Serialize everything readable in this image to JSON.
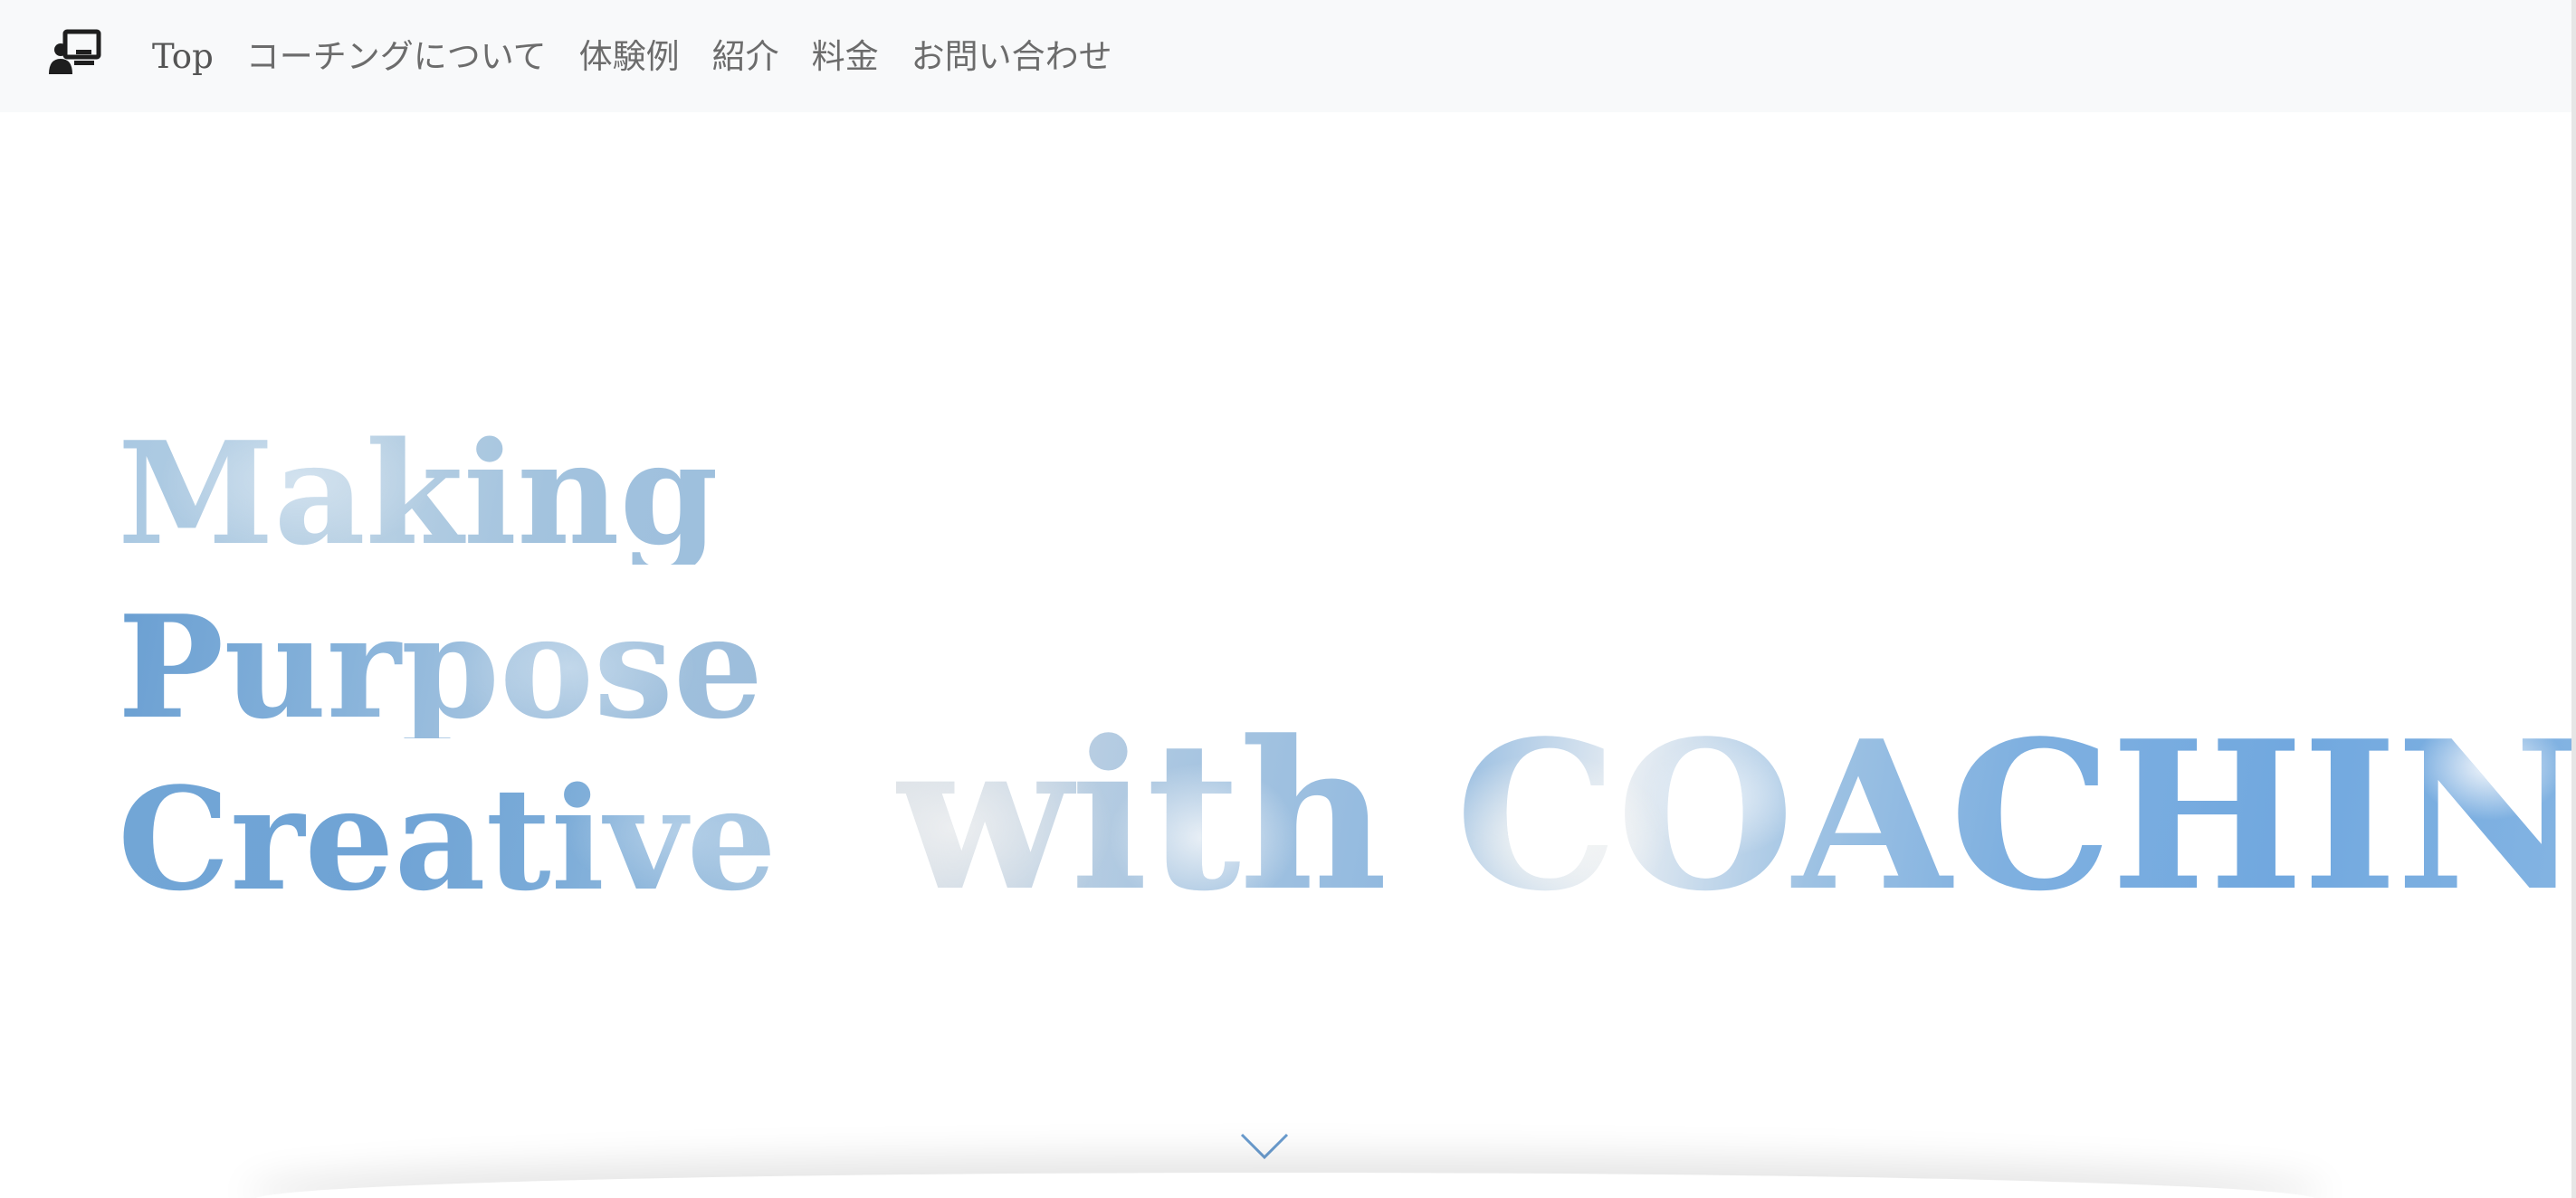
{
  "navbar": {
    "brand_icon": "presenter-board-icon",
    "links": [
      {
        "label": "Top"
      },
      {
        "label": "コーチングについて"
      },
      {
        "label": "体験例"
      },
      {
        "label": "紹介"
      },
      {
        "label": "料金"
      },
      {
        "label": "お問い合わせ"
      }
    ]
  },
  "hero": {
    "line1": "Making",
    "line2": "Purpose",
    "line3": "Creative",
    "tagline": "with COACHING.",
    "scroll_icon": "chevron-down-icon"
  },
  "colors": {
    "navbar_bg": "#f8f9fa",
    "nav_text": "#6c6c6c",
    "sky_blue": "#7aabde",
    "chevron": "#6a9ccf"
  }
}
